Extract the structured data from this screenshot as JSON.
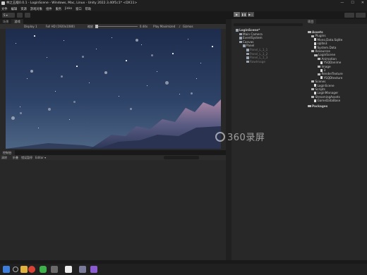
{
  "window": {
    "title": "林之五级0.0.1 - LoginScene - Windows, Mac, Linux - Unity 2022.3.40f1c1* <DX11>",
    "controls": [
      "—",
      "☐",
      "✕"
    ]
  },
  "menubar": [
    "文件",
    "编辑",
    "资源",
    "游戏对象",
    "组件",
    "服务",
    "Jinks",
    "窗口",
    "帮助"
  ],
  "toolbar": {
    "account": "S ▾",
    "tooltip": "Play"
  },
  "game_view": {
    "tabs": [
      "场景",
      "游戏"
    ],
    "display": "Display 1",
    "resolution": "Full HD (1920x1080)",
    "scale_label": "缩放",
    "scale_value": "0.44x",
    "play_mode": "Play Maximized",
    "gizmos": "Gizmos"
  },
  "console": {
    "tab": "控制台",
    "toolbar": [
      "清除",
      "折叠",
      "错误暂停",
      "Editor ▾"
    ]
  },
  "hierarchy": {
    "items": [
      {
        "label": "LoginScene*",
        "depth": 0,
        "bold": true
      },
      {
        "label": "Main Camera",
        "depth": 1
      },
      {
        "label": "EventSystem",
        "depth": 1
      },
      {
        "label": "Canvas",
        "depth": 1
      },
      {
        "label": "Panel",
        "depth": 2
      },
      {
        "label": "Panel_L_1_1",
        "depth": 3,
        "dim": true
      },
      {
        "label": "Panel_L_1_2",
        "depth": 3,
        "dim": true
      },
      {
        "label": "Panel_L_1_3",
        "depth": 3,
        "dim": true
      },
      {
        "label": "RawImage",
        "depth": 3,
        "dim": true
      }
    ]
  },
  "project": {
    "tab": "项目",
    "items": [
      {
        "label": "Assets",
        "depth": 0,
        "type": "folder",
        "bold": true
      },
      {
        "label": "Plugins",
        "depth": 1,
        "type": "folder"
      },
      {
        "label": "Mono.Data.Sqlite",
        "depth": 2,
        "type": "file"
      },
      {
        "label": "sqlite3",
        "depth": 2,
        "type": "file"
      },
      {
        "label": "System.Data",
        "depth": 2,
        "type": "file"
      },
      {
        "label": "Resources",
        "depth": 1,
        "type": "folder"
      },
      {
        "label": "LoginScene",
        "depth": 2,
        "type": "folder"
      },
      {
        "label": "Animation",
        "depth": 3,
        "type": "folder"
      },
      {
        "label": "YSQDanime",
        "depth": 4,
        "type": "file"
      },
      {
        "label": "Image",
        "depth": 3,
        "type": "folder"
      },
      {
        "label": "3",
        "depth": 4,
        "type": "file"
      },
      {
        "label": "RenderTexture",
        "depth": 3,
        "type": "folder"
      },
      {
        "label": "YSQDtexture",
        "depth": 4,
        "type": "file"
      },
      {
        "label": "Scenes",
        "depth": 1,
        "type": "folder"
      },
      {
        "label": "LoginScene",
        "depth": 2,
        "type": "file"
      },
      {
        "label": "Scripts",
        "depth": 1,
        "type": "folder"
      },
      {
        "label": "LoginManager",
        "depth": 2,
        "type": "file"
      },
      {
        "label": "StreamingAssets",
        "depth": 1,
        "type": "folder"
      },
      {
        "label": "GameDataBase",
        "depth": 2,
        "type": "file"
      },
      {
        "label": "Packages",
        "depth": 0,
        "type": "folder",
        "bold": true
      }
    ]
  },
  "watermark": "360录屏",
  "colors": {
    "play_active": "#6a6a6a",
    "sky_top": "#1d2c4d",
    "sky_bottom": "#4d6585"
  }
}
